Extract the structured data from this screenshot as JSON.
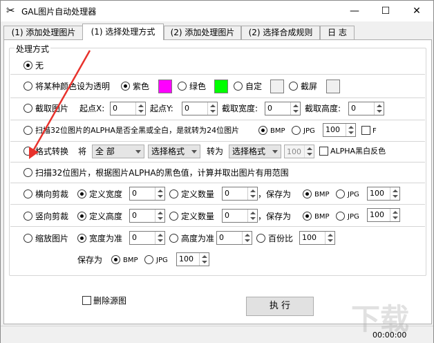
{
  "window": {
    "title": "GAL图片自动处理器",
    "icon": "scissors-icon",
    "minimize": "—",
    "maximize": "☐",
    "close": "✕"
  },
  "tabs": [
    "(1) 添加处理图片",
    "(1) 选择处理方式",
    "(2) 添加处理图片",
    "(2) 选择合成规则",
    "日 志"
  ],
  "group_label": "处理方式",
  "rows": {
    "none": "无",
    "transparent": {
      "label": "将某种颜色设为透明",
      "purple": "紫色",
      "green": "绿色",
      "custom": "自定",
      "screen": "截屏"
    },
    "crop": {
      "label": "截取图片",
      "start_x": "起点X:",
      "start_y": "起点Y:",
      "width": "截取宽度:",
      "height": "截取高度:",
      "v1": "0",
      "v2": "0",
      "v3": "0",
      "v4": "0"
    },
    "alpha32": {
      "label": "扫描32位图片的ALPHA是否全黑或全白，是就转为24位图片",
      "bmp": "BMP",
      "jpg": "JPG",
      "quality": "100",
      "f": "F"
    },
    "format": {
      "label": "格式转换",
      "from": "将",
      "all": "全 部",
      "pick1": "选择格式",
      "to": "转为",
      "pick2": "选择格式",
      "quality": "100",
      "alpha_invert": "ALPHA黑白反色"
    },
    "scan": {
      "label": "扫描32位图片，根据图片ALPHA的黑色值，计算并取出图片有用范围"
    },
    "hcut": {
      "label": "横向剪裁",
      "def_width": "定义宽度",
      "w": "0",
      "def_count": "定义数量",
      "c": "0",
      "save_as": "，保存为",
      "bmp": "BMP",
      "jpg": "JPG",
      "quality": "100"
    },
    "vcut": {
      "label": "竖向剪裁",
      "def_height": "定义高度",
      "h": "0",
      "def_count": "定义数量",
      "c": "0",
      "save_as": "，保存为",
      "bmp": "BMP",
      "jpg": "JPG",
      "quality": "100"
    },
    "scale": {
      "label": "缩放图片",
      "by_width": "宽度为准",
      "w": "0",
      "by_height": "高度为准",
      "h": "0",
      "percent": "百份比",
      "p": "100",
      "save_as": "保存为",
      "bmp": "BMP",
      "jpg": "JPG",
      "quality": "100"
    }
  },
  "delete_source": "删除源图",
  "execute": "执 行",
  "status_time": "00:00:00",
  "colors": {
    "purple_swatch": "#ff00ff",
    "green_swatch": "#00ff00",
    "arrow": "#e8322c"
  }
}
